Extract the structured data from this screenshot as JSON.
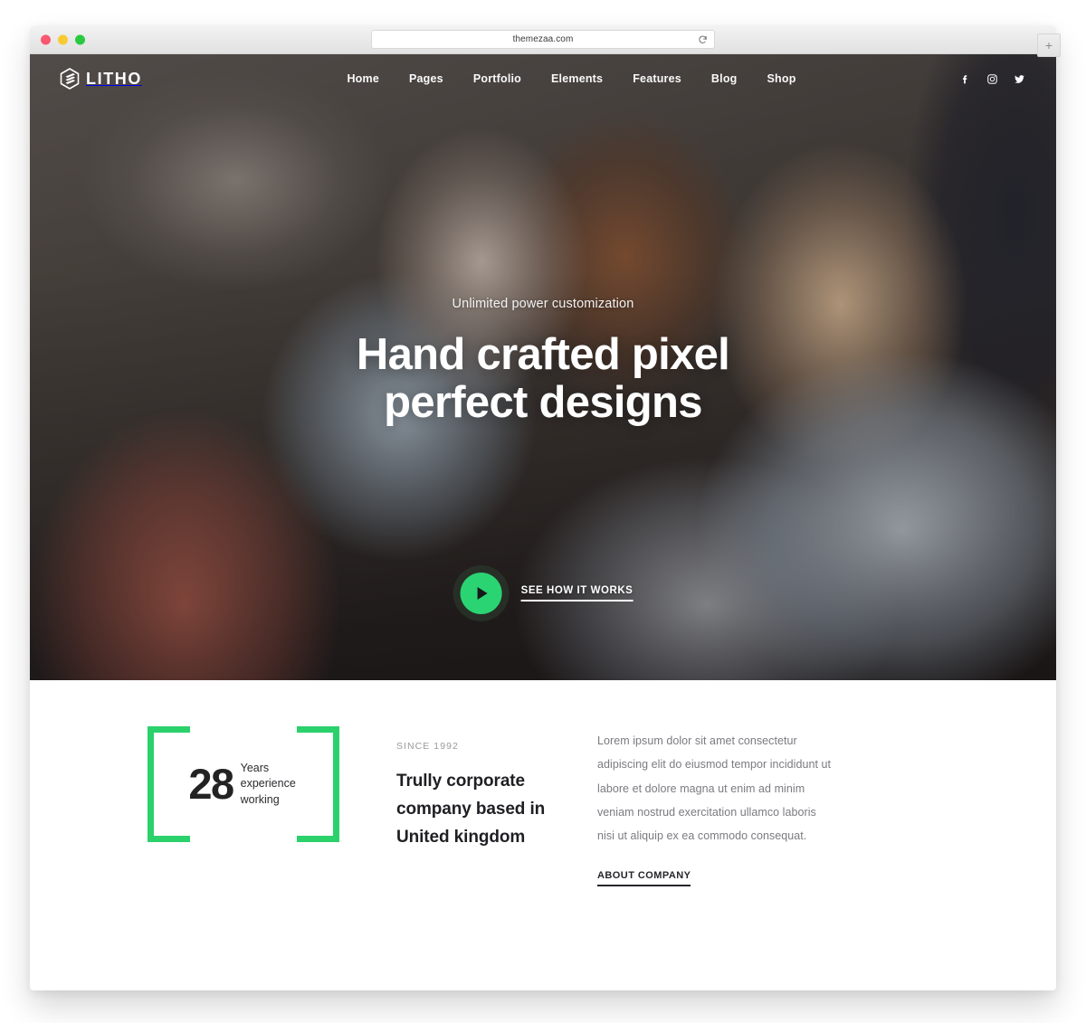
{
  "browser": {
    "url": "themezaa.com",
    "reload_icon": "reload-icon",
    "new_tab_label": "+",
    "traffic_lights": [
      "close-red",
      "minimize-yellow",
      "maximize-green"
    ]
  },
  "site": {
    "brand": {
      "name": "LITHO",
      "mark_icon": "hexagon-layers-logo-icon"
    },
    "nav": {
      "items": [
        {
          "label": "Home"
        },
        {
          "label": "Pages"
        },
        {
          "label": "Portfolio"
        },
        {
          "label": "Elements"
        },
        {
          "label": "Features"
        },
        {
          "label": "Blog"
        },
        {
          "label": "Shop"
        }
      ],
      "social": [
        {
          "icon": "facebook-icon",
          "label": "Facebook"
        },
        {
          "icon": "instagram-icon",
          "label": "Instagram"
        },
        {
          "icon": "twitter-icon",
          "label": "Twitter"
        }
      ]
    },
    "hero": {
      "subtitle": "Unlimited power customization",
      "title_line1": "Hand crafted pixel",
      "title_line2": "perfect designs",
      "cta_label": "SEE HOW IT WORKS",
      "play_icon": "play-icon"
    },
    "about": {
      "stat_number": "28",
      "stat_caption": "Years experience working",
      "eyebrow": "SINCE 1992",
      "title": "Trully corporate company based in United kingdom",
      "paragraph": "Lorem ipsum dolor sit amet consectetur adipiscing elit do eiusmod tempor incididunt ut labore et dolore magna ut enim ad minim veniam nostrud exercitation ullamco laboris nisi ut aliquip ex ea commodo consequat.",
      "link_label": "ABOUT COMPANY"
    }
  },
  "colors": {
    "accent_green": "#2bd16b",
    "play_green": "#2bd472",
    "heading_dark": "#1f1f24",
    "body_gray": "#7b7b80"
  }
}
